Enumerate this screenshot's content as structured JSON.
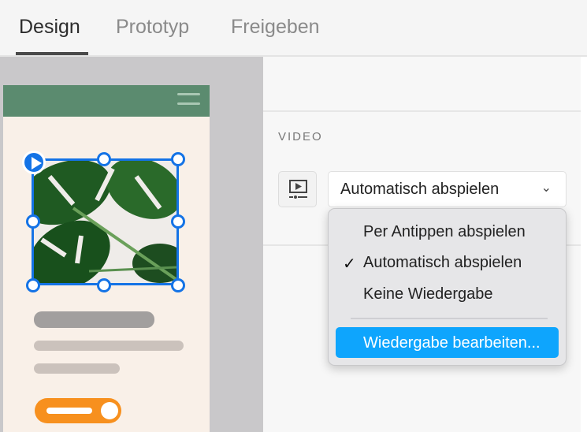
{
  "tabs": [
    {
      "label": "Design"
    },
    {
      "label": "Prototyp"
    },
    {
      "label": "Freigeben"
    }
  ],
  "panel": {
    "section_label": "VIDEO",
    "playback_select": {
      "value": "Automatisch abspielen",
      "icon": "chevron-down-icon"
    },
    "menu": {
      "items": [
        {
          "label": "Per Antippen abspielen",
          "checked": false
        },
        {
          "label": "Automatisch abspielen",
          "checked": true
        },
        {
          "label": "Keine Wiedergabe",
          "checked": false
        }
      ],
      "edit_item": "Wiedergabe bearbeiten...",
      "check_glyph": "✓"
    }
  },
  "colors": {
    "accent": "#1473e6",
    "highlight": "#0ea5fd",
    "header_green": "#5b8b6f",
    "button_orange": "#f7901e"
  }
}
